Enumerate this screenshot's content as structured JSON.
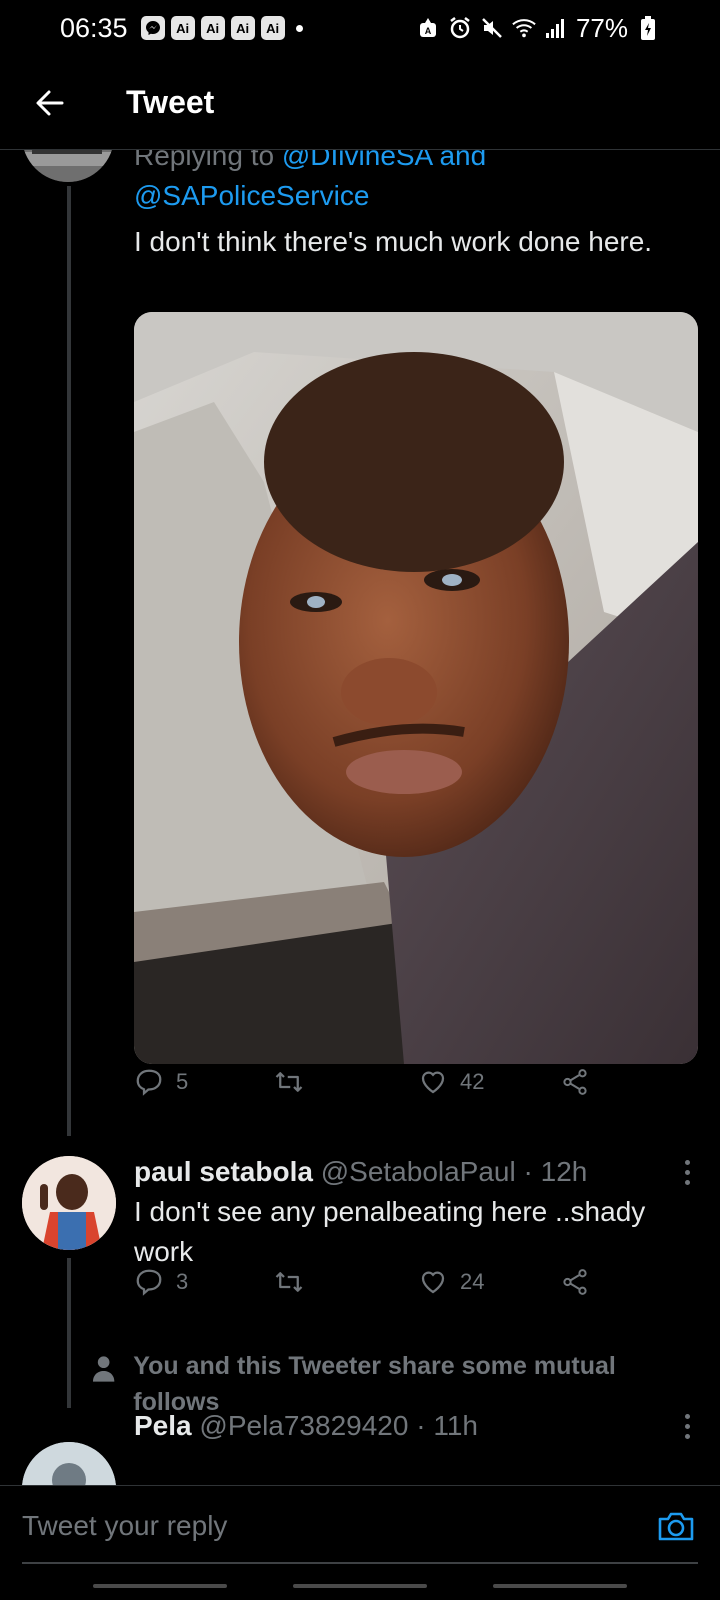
{
  "status_bar": {
    "time": "06:35",
    "notification_badges": [
      "Ai",
      "Ai",
      "Ai",
      "Ai"
    ],
    "battery": "77%",
    "icons": [
      "messenger-icon",
      "ai-icon",
      "alarm-icon",
      "mute-icon",
      "wifi-icon",
      "signal-icon",
      "battery-icon"
    ]
  },
  "header": {
    "title": "Tweet"
  },
  "main_tweet": {
    "replying_prefix": "Replying to",
    "mention_1": "@DIivineSA",
    "and_word": "and",
    "mention_2": "@SAPoliceService",
    "text": "I don't think there's much work done here.",
    "actions": {
      "replies": "5",
      "retweets": "",
      "likes": "42"
    }
  },
  "reply": {
    "name": "paul setabola",
    "handle": "@SetabolaPaul",
    "time": "12h",
    "text": "I don't see any penalbeating here ..shady work",
    "actions": {
      "replies": "3",
      "retweets": "",
      "likes": "24"
    }
  },
  "mutual_notice": "You and this Tweeter share some mutual follows",
  "next_reply": {
    "name": "Pela",
    "handle": "@Pela73829420",
    "time": "11h"
  },
  "reply_bar": {
    "placeholder": "Tweet your reply"
  },
  "colors": {
    "background": "#000000",
    "accent": "#1d9bf0",
    "secondary_text": "#71767b",
    "primary_text": "#e7e9ea"
  }
}
